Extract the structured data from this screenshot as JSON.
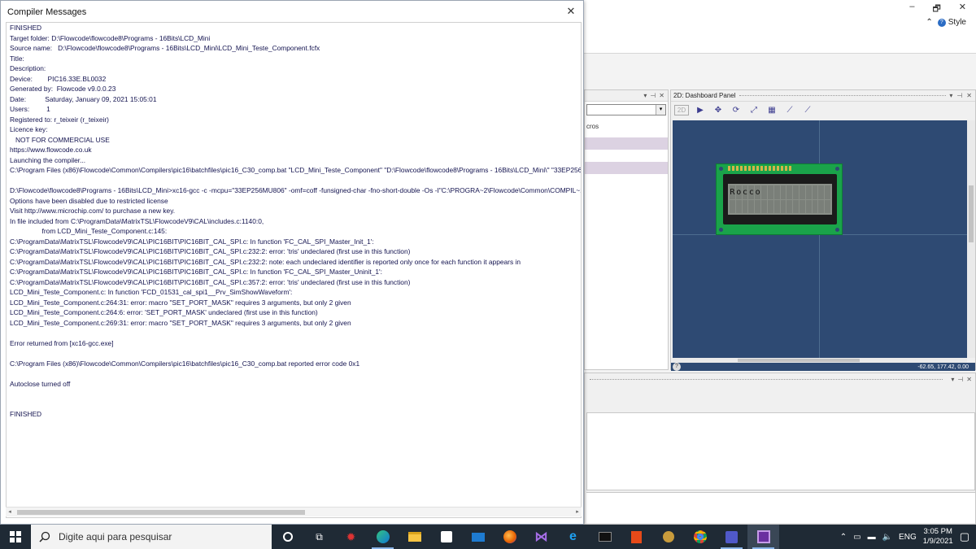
{
  "ribbon": {
    "window_controls": [
      "–",
      "🗗",
      "✕"
    ],
    "style_label": "Style"
  },
  "left_panel": {
    "macros_label": "cros"
  },
  "dashboard": {
    "title": "2D: Dashboard Panel",
    "two_d_label": "2D",
    "coords": "-62.65, 177.42, 0.00",
    "lcd_row1": [
      "R",
      "o",
      "c",
      "c",
      "o",
      "",
      "",
      "",
      "",
      "",
      "",
      "",
      "",
      "",
      "",
      ""
    ]
  },
  "dialog": {
    "title": "Compiler Messages",
    "lines": [
      "FINISHED",
      "Target folder: D:\\Flowcode\\flowcode8\\Programs - 16Bits\\LCD_Mini",
      "Source name:   D:\\Flowcode\\flowcode8\\Programs - 16Bits\\LCD_Mini\\LCD_Mini_Teste_Component.fcfx",
      "Title:",
      "Description:",
      "Device:        PIC16.33E.BL0032",
      "Generated by:  Flowcode v9.0.0.23",
      "Date:          Saturday, January 09, 2021 15:05:01",
      "Users:         1",
      "Registered to: r_teixeir (r_teixeir)",
      "Licence key:",
      "   NOT FOR COMMERCIAL USE",
      "https://www.flowcode.co.uk",
      "Launching the compiler...",
      "C:\\Program Files (x86)\\Flowcode\\Common\\Compilers\\pic16\\batchfiles\\pic16_C30_comp.bat \"LCD_Mini_Teste_Component\" \"D:\\Flowcode\\flowcode8\\Programs - 16Bits\\LCD_Mini\\\" \"33EP256",
      "",
      "D:\\Flowcode\\flowcode8\\Programs - 16Bits\\LCD_Mini>xc16-gcc -c -mcpu=\"33EP256MU806\" -omf=coff -funsigned-char -fno-short-double -Os -I\"C:\\PROGRA~2\\Flowcode\\Common\\COMPIL~1\\p",
      "Options have been disabled due to restricted license",
      "Visit http://www.microchip.com/ to purchase a new key.",
      "In file included from C:\\ProgramData\\MatrixTSL\\FlowcodeV9\\CAL\\includes.c:1140:0,",
      "                 from LCD_Mini_Teste_Component.c:145:",
      "C:\\ProgramData\\MatrixTSL\\FlowcodeV9\\CAL\\PIC16BIT\\PIC16BIT_CAL_SPI.c: In function 'FC_CAL_SPI_Master_Init_1':",
      "C:\\ProgramData\\MatrixTSL\\FlowcodeV9\\CAL\\PIC16BIT\\PIC16BIT_CAL_SPI.c:232:2: error: 'tris' undeclared (first use in this function)",
      "C:\\ProgramData\\MatrixTSL\\FlowcodeV9\\CAL\\PIC16BIT\\PIC16BIT_CAL_SPI.c:232:2: note: each undeclared identifier is reported only once for each function it appears in",
      "C:\\ProgramData\\MatrixTSL\\FlowcodeV9\\CAL\\PIC16BIT\\PIC16BIT_CAL_SPI.c: In function 'FC_CAL_SPI_Master_Uninit_1':",
      "C:\\ProgramData\\MatrixTSL\\FlowcodeV9\\CAL\\PIC16BIT\\PIC16BIT_CAL_SPI.c:357:2: error: 'tris' undeclared (first use in this function)",
      "LCD_Mini_Teste_Component.c: In function 'FCD_01531_cal_spi1__Prv_SimShowWaveform':",
      "LCD_Mini_Teste_Component.c:264:31: error: macro \"SET_PORT_MASK\" requires 3 arguments, but only 2 given",
      "LCD_Mini_Teste_Component.c:264:6: error: 'SET_PORT_MASK' undeclared (first use in this function)",
      "LCD_Mini_Teste_Component.c:269:31: error: macro \"SET_PORT_MASK\" requires 3 arguments, but only 2 given",
      "",
      "Error returned from [xc16-gcc.exe]",
      "",
      "C:\\Program Files (x86)\\Flowcode\\Common\\Compilers\\pic16\\batchfiles\\pic16_C30_comp.bat reported error code 0x1",
      "",
      "Autoclose turned off",
      "",
      "",
      "FINISHED"
    ]
  },
  "taskbar": {
    "search_placeholder": "Digite aqui para pesquisar",
    "language": "ENG",
    "time": "3:05 PM",
    "date": "1/9/2021"
  },
  "colors": {
    "canvas": "#2e4a73",
    "pcb": "#1aa34a",
    "taskbar": "#1f2a35",
    "message_text": "#141450"
  }
}
